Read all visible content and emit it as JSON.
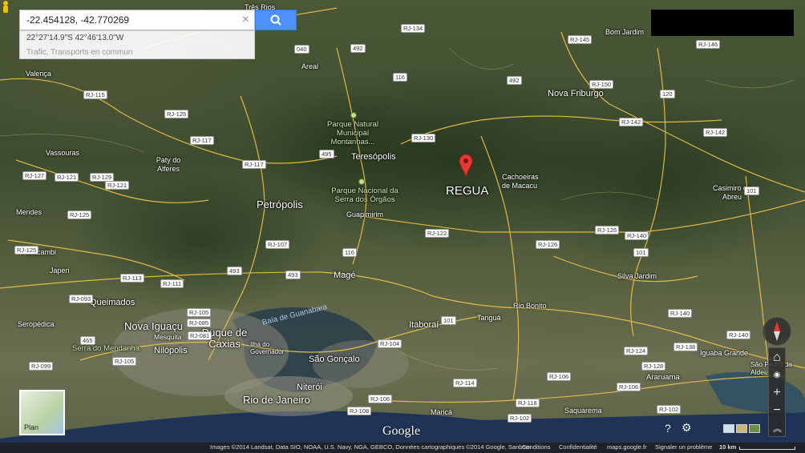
{
  "search": {
    "value": "-22.454128, -42.770269",
    "clear_glyph": "×",
    "suggestion_coords": "22°27'14.9\"S 42°46'13.0\"W",
    "suggestion_layers": "Trafic, Transports en commun",
    "search_icon": "search-icon"
  },
  "map": {
    "marker_label": "REGUA",
    "cities_big": [
      "Petrópolis",
      "Teresópolis",
      "Nova Friburgo",
      "Nova Iguaçu",
      "Duque de Caxias",
      "Rio de Janeiro",
      "Niterói",
      "São Gonçalo",
      "Itaboraí",
      "Magé",
      "Queimados",
      "Nilópolis"
    ],
    "cities": [
      "Valença",
      "Vassouras",
      "Paty do Alferes",
      "Mendes",
      "Paracambi",
      "Japeri",
      "Seropédica",
      "Guapimirim",
      "Cachoeiras de Macacu",
      "Casimiro de Abreu",
      "Silva Jardim",
      "Rio Bonito",
      "Tanguá",
      "Araruama",
      "Iguaba Grande",
      "Saquarema",
      "Maricá",
      "Bom Jardim",
      "Areal",
      "Três Rios",
      "Mesquita",
      "Ilha do Governador",
      "São Pedro da Aldeia"
    ],
    "parks": [
      "Parque Natural Municipal Montanhas...",
      "Parque Nacional da Serra dos Órgãos",
      "Serra do Mendanha"
    ],
    "water": [
      "Baía de Guanabara"
    ],
    "shields": [
      "RJ-134",
      "040",
      "492",
      "116",
      "RJ-130",
      "492",
      "RJ-145",
      "RJ-146",
      "RJ-150",
      "120",
      "RJ-142",
      "RJ-142",
      "RJ-115",
      "RJ-125",
      "RJ-117",
      "RJ-117",
      "495",
      "RJ-127",
      "RJ-121",
      "RJ-129",
      "RJ-121",
      "RJ-125",
      "RJ-125",
      "RJ-107",
      "116",
      "RJ-122",
      "RJ-126",
      "RJ-126",
      "RJ-140",
      "101",
      "RJ-113",
      "RJ-111",
      "493",
      "493",
      "RJ-093",
      "RJ-105",
      "RJ-085",
      "RJ-081",
      "465",
      "RJ-105",
      "RJ-099",
      "RJ-104",
      "101",
      "RJ-114",
      "RJ-106",
      "RJ-108",
      "RJ-106",
      "RJ-118",
      "RJ-102",
      "RJ-124",
      "RJ-138",
      "RJ-140",
      "RJ-140",
      "RJ-102",
      "RJ-106",
      "RJ-128",
      "101"
    ],
    "scale": "10 km"
  },
  "controls": {
    "plan_label": "Plan",
    "zoom_in": "+",
    "zoom_out": "−",
    "help_icon": "help-icon",
    "settings_icon": "gear-icon",
    "expand_icon": "chevron-up-icon"
  },
  "footer": {
    "google": "Google",
    "attribution": "Images ©2014 Landsat, Data SIO, NOAA, U.S. Navy, NGA, GEBCO, Données cartographiques ©2014 Google, Sanborn",
    "conditions": "Conditions",
    "privacy": "Confidentialité",
    "site": "maps.google.fr",
    "report": "Signaler un problème",
    "scale": "10 km"
  },
  "colors": {
    "roads": "#f0c34a",
    "marker": "#e53935",
    "search_button": "#4d90fe"
  }
}
